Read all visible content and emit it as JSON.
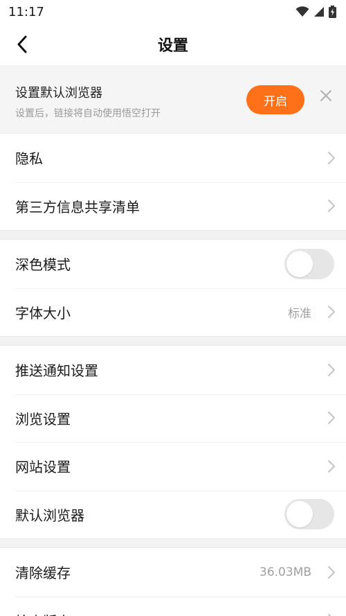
{
  "status_bar": {
    "time": "11:17"
  },
  "nav": {
    "title": "设置"
  },
  "banner": {
    "title": "设置默认浏览器",
    "subtitle": "设置后，链接将自动使用悟空打开",
    "open_label": "开启"
  },
  "groups": [
    {
      "items": [
        {
          "label": "隐私"
        },
        {
          "label": "第三方信息共享清单"
        }
      ]
    },
    {
      "items": [
        {
          "label": "深色模式",
          "toggle_on": false
        },
        {
          "label": "字体大小",
          "value": "标准"
        }
      ]
    },
    {
      "items": [
        {
          "label": "推送通知设置"
        },
        {
          "label": "浏览设置"
        },
        {
          "label": "网站设置"
        },
        {
          "label": "默认浏览器",
          "toggle_on": false
        }
      ]
    },
    {
      "items": [
        {
          "label": "清除缓存",
          "value": "36.03MB"
        },
        {
          "label": "检查版本"
        }
      ]
    }
  ],
  "colors": {
    "accent": "#ff7118",
    "toggle_off": "#e6e6e6"
  }
}
